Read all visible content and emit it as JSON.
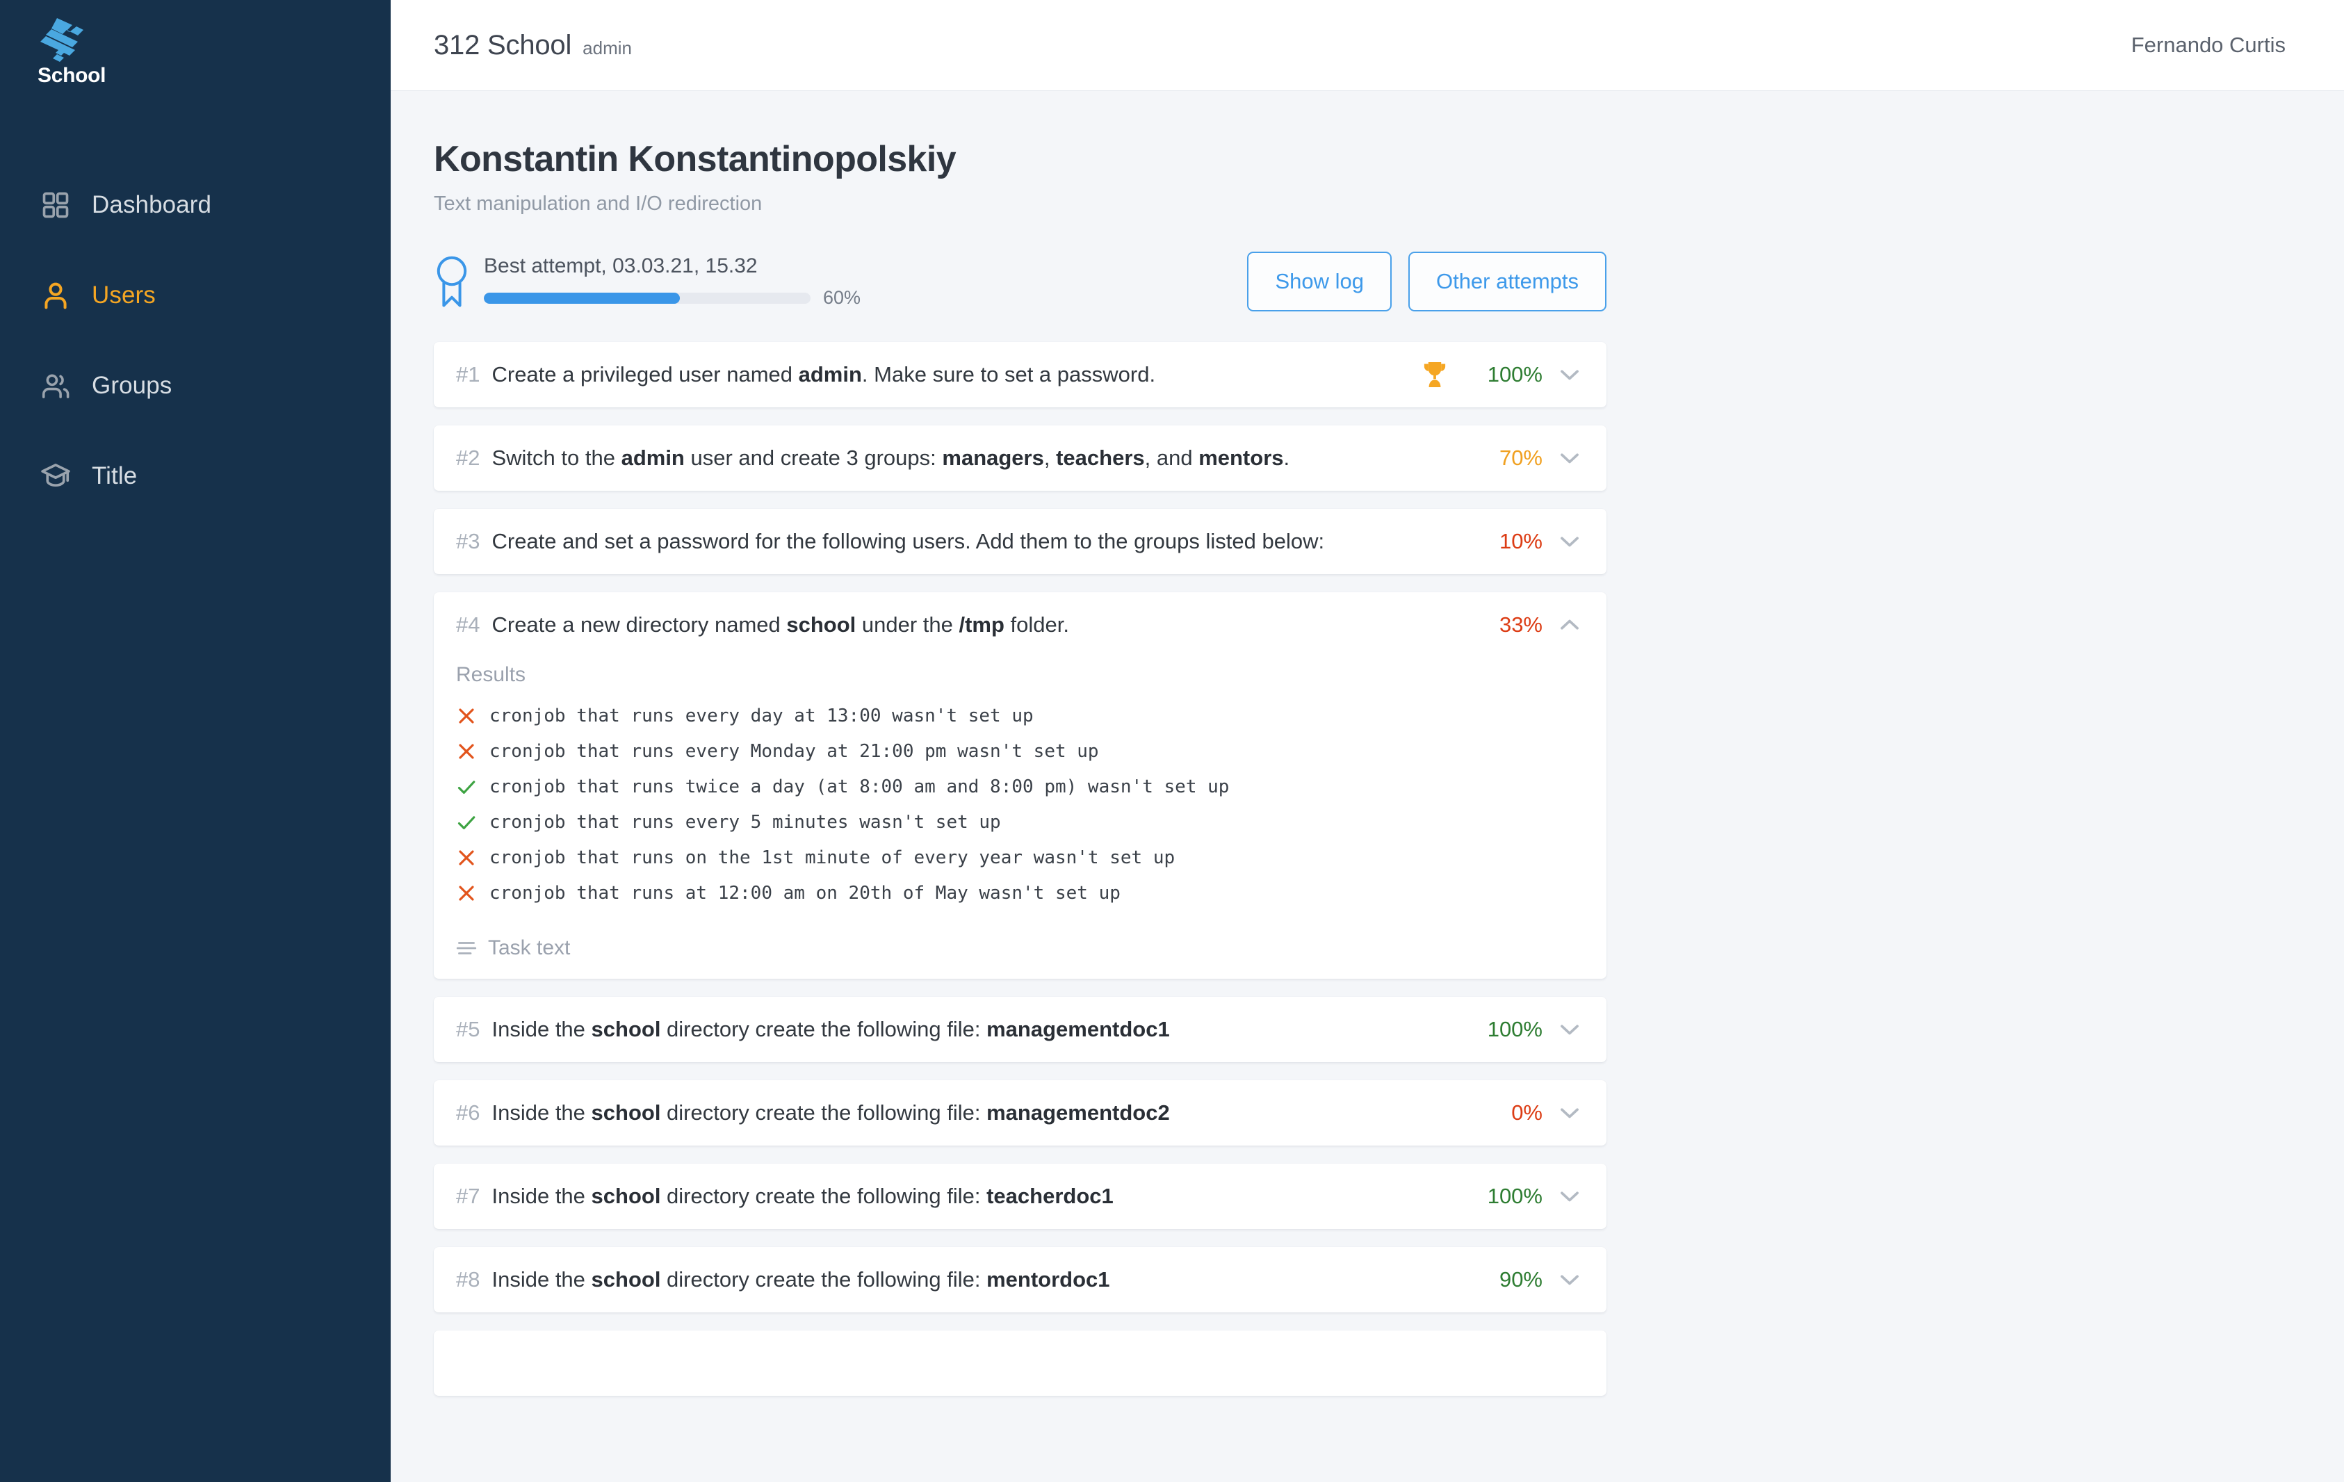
{
  "colors": {
    "sidebar_bg": "#16314b",
    "content_bg": "#f4f6f9",
    "accent_blue": "#3a96e8",
    "accent_orange": "#f5a623",
    "green": "#2e7d32",
    "amber": "#f0a020",
    "red": "#dc3c14",
    "logo_blue": "#4aa8e0"
  },
  "sidebar": {
    "logo_word": "School",
    "logo_icon": "isometric-school-logo-icon",
    "items": [
      {
        "label": "Dashboard",
        "icon": "grid-icon",
        "active": false
      },
      {
        "label": "Users",
        "icon": "user-icon",
        "active": true
      },
      {
        "label": "Groups",
        "icon": "users-group-icon",
        "active": false
      },
      {
        "label": "Title",
        "icon": "graduation-cap-icon",
        "active": false
      }
    ]
  },
  "topbar": {
    "brand_title": "312 School",
    "brand_sub": "admin",
    "account_name": "Fernando Curtis"
  },
  "page": {
    "title": "Konstantin Konstantinopolskiy",
    "subtitle": "Text manipulation and I/O redirection"
  },
  "attempt": {
    "badge_icon": "award-ribbon-icon",
    "label": "Best attempt, 03.03.21, 15.32",
    "progress_percent": 60,
    "progress_text": "60%",
    "buttons": [
      {
        "label": "Show log",
        "name": "show-log-button"
      },
      {
        "label": "Other attempts",
        "name": "other-attempts-button"
      }
    ]
  },
  "tasks": [
    {
      "num": "#1",
      "text_html": "Create a privileged user named <b>admin</b>. Make sure to set a password.",
      "percent": "100%",
      "percent_class": "pct-green",
      "trophy": true,
      "expanded": false,
      "chevron": "chevron-down-icon"
    },
    {
      "num": "#2",
      "text_html": "Switch to the <b>admin</b> user and create 3 groups: <b>managers</b>, <b>teachers</b>, and <b>mentors</b>.",
      "percent": "70%",
      "percent_class": "pct-amber",
      "trophy": false,
      "expanded": false,
      "chevron": "chevron-down-icon"
    },
    {
      "num": "#3",
      "text_html": "Create and set a password for the following users. Add them to the groups listed below:",
      "percent": "10%",
      "percent_class": "pct-red",
      "trophy": false,
      "expanded": false,
      "chevron": "chevron-down-icon"
    },
    {
      "num": "#4",
      "text_html": "Create a new directory named <b>school</b> under the <b>/tmp</b> folder.",
      "percent": "33%",
      "percent_class": "pct-red",
      "trophy": false,
      "expanded": true,
      "chevron": "chevron-up-icon",
      "results_label": "Results",
      "results": [
        {
          "status": "fail",
          "text": "cronjob that runs every day at 13:00 wasn't set up"
        },
        {
          "status": "fail",
          "text": "cronjob that runs every Monday at 21:00 pm wasn't set up"
        },
        {
          "status": "pass",
          "text": "cronjob that runs twice a day (at 8:00 am and 8:00 pm) wasn't set up"
        },
        {
          "status": "pass",
          "text": "cronjob that runs every 5 minutes wasn't set up"
        },
        {
          "status": "fail",
          "text": "cronjob that runs on the 1st minute of every year wasn't set up"
        },
        {
          "status": "fail",
          "text": "cronjob that runs at 12:00 am on 20th of May wasn't set up"
        }
      ],
      "footer_label": "Task text",
      "footer_icon": "list-lines-icon"
    },
    {
      "num": "#5",
      "text_html": "Inside the <b>school</b> directory create the following file: <b>managementdoc1</b>",
      "percent": "100%",
      "percent_class": "pct-green",
      "trophy": false,
      "expanded": false,
      "chevron": "chevron-down-icon"
    },
    {
      "num": "#6",
      "text_html": "Inside the <b>school</b> directory create the following file: <b>managementdoc2</b>",
      "percent": "0%",
      "percent_class": "pct-red",
      "trophy": false,
      "expanded": false,
      "chevron": "chevron-down-icon"
    },
    {
      "num": "#7",
      "text_html": "Inside the <b>school</b> directory create the following file: <b>teacherdoc1</b>",
      "percent": "100%",
      "percent_class": "pct-green",
      "trophy": false,
      "expanded": false,
      "chevron": "chevron-down-icon"
    },
    {
      "num": "#8",
      "text_html": "Inside the <b>school</b> directory create the following file: <b>mentordoc1</b>",
      "percent": "90%",
      "percent_class": "pct-green",
      "trophy": false,
      "expanded": false,
      "chevron": "chevron-down-icon"
    },
    {
      "num": "",
      "text_html": "",
      "percent": "",
      "percent_class": "",
      "trophy": false,
      "expanded": false,
      "partial": true,
      "chevron": "chevron-down-icon"
    }
  ]
}
